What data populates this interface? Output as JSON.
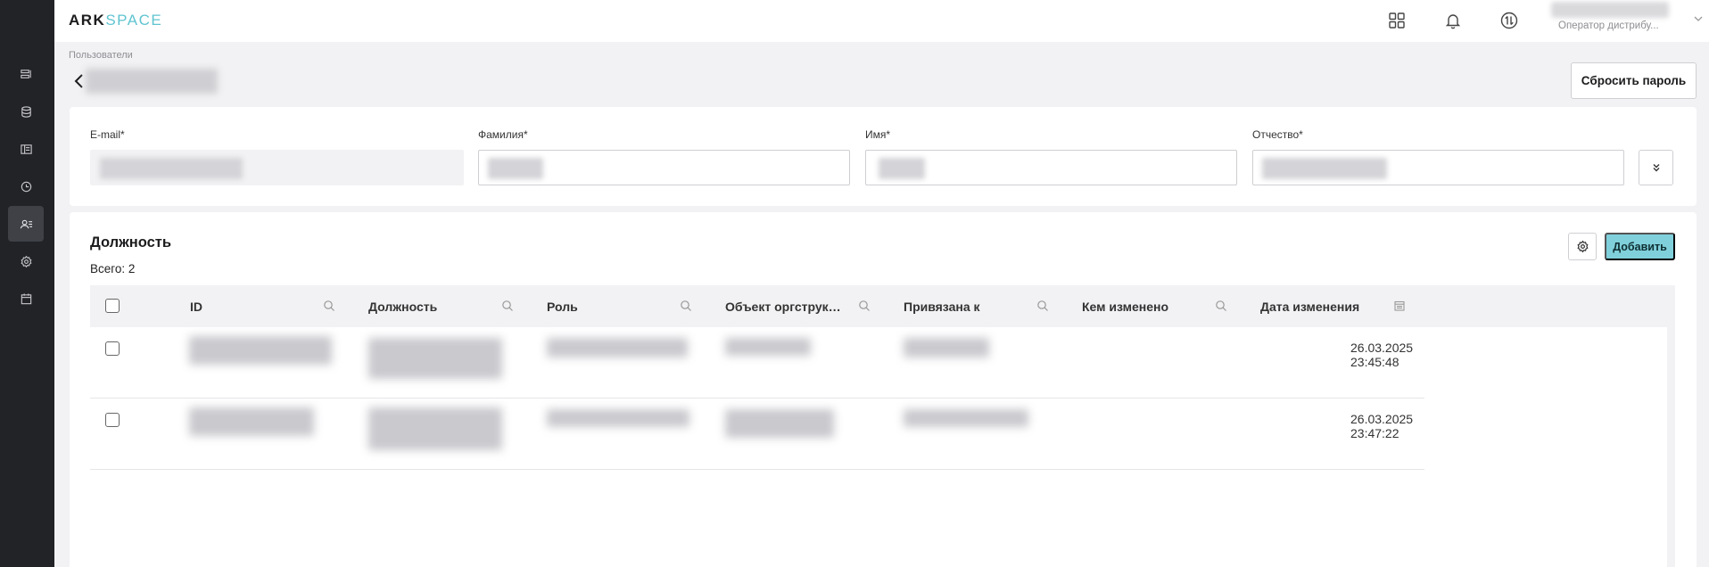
{
  "app": {
    "logo_part1": "ARK",
    "logo_part2": "SPACE",
    "accent_color": "#7fd0da"
  },
  "topbar": {
    "icons": [
      "apps-grid-icon",
      "bell-icon",
      "sync-icon"
    ],
    "user_role": "Оператор дистрибу..."
  },
  "sidebar": {
    "items": [
      {
        "icon": "list-icon",
        "active": false
      },
      {
        "icon": "database-icon",
        "active": false
      },
      {
        "icon": "layout-icon",
        "active": false
      },
      {
        "icon": "clock-icon",
        "active": false
      },
      {
        "icon": "users-icon",
        "active": true
      },
      {
        "icon": "settings-icon",
        "active": false
      },
      {
        "icon": "calendar-icon",
        "active": false
      }
    ]
  },
  "page": {
    "breadcrumb": "Пользователи",
    "reset_password_label": "Сбросить пароль"
  },
  "form": {
    "email_label": "E-mail*",
    "last_name_label": "Фамилия*",
    "first_name_label": "Имя*",
    "middle_name_label": "Отчество*"
  },
  "positions": {
    "title": "Должность",
    "total_label": "Всего: 2",
    "add_label": "Добавить",
    "columns": [
      "ID",
      "Должность",
      "Роль",
      "Объект оргструкт...",
      "Привязана к",
      "Кем изменено",
      "Дата изменения"
    ],
    "rows": [
      {
        "changed_at": "26.03.2025 23:45:48"
      },
      {
        "changed_at": "26.03.2025 23:47:22"
      }
    ]
  }
}
